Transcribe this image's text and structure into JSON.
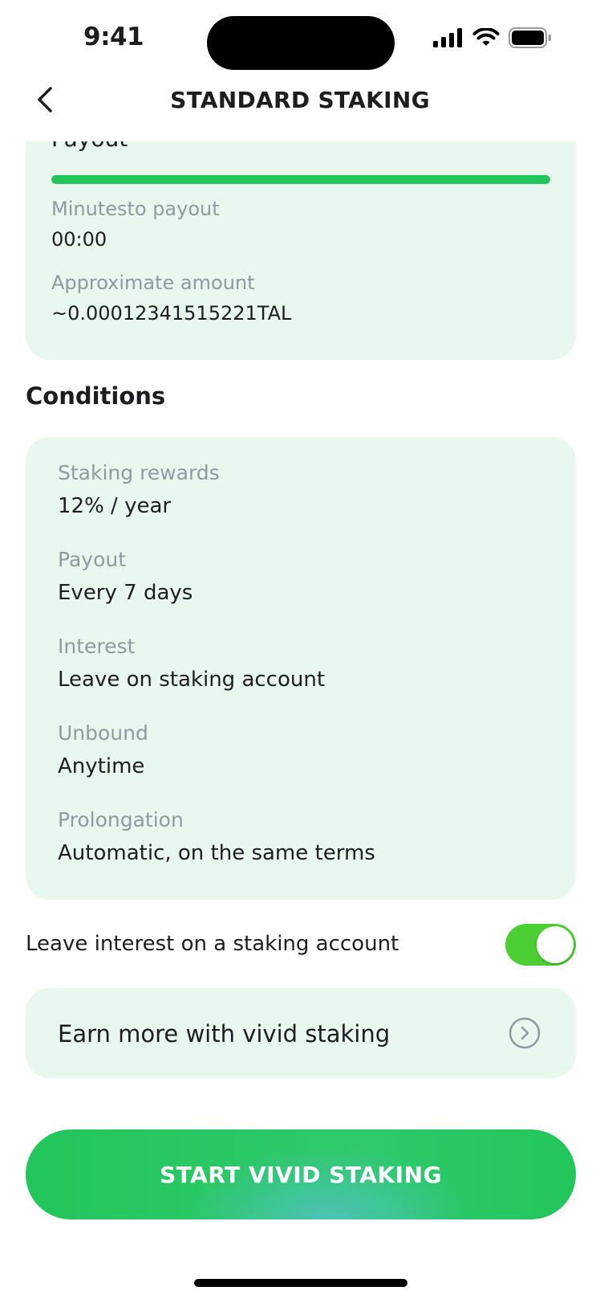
{
  "status": {
    "time": "9:41"
  },
  "header": {
    "title": "STANDARD STAKING"
  },
  "payout_card": {
    "heading": "Payout",
    "progress_percent": 100,
    "minutes_label": "Minutesto payout",
    "minutes_value": "00:00",
    "amount_label": "Approximate amount",
    "amount_value": "~0.00012341515221TAL"
  },
  "conditions": {
    "title": "Conditions",
    "items": [
      {
        "label": "Staking rewards",
        "value": "12% / year"
      },
      {
        "label": "Payout",
        "value": "Every 7 days"
      },
      {
        "label": "Interest",
        "value": "Leave on staking account"
      },
      {
        "label": "Unbound",
        "value": "Anytime"
      },
      {
        "label": "Prolongation",
        "value": "Automatic, on the same terms"
      }
    ]
  },
  "toggle": {
    "label": "Leave interest on a staking account",
    "enabled": true
  },
  "promo": {
    "text": "Earn more with vivid staking"
  },
  "cta": {
    "label": "START VIVID STAKING"
  },
  "colors": {
    "accent": "#22c65a",
    "card_bg": "#e8f8ee",
    "toggle_on": "#4ccf33"
  },
  "icons": [
    "back-chevron-icon",
    "signal-icon",
    "wifi-icon",
    "battery-icon",
    "chevron-right-circle-icon"
  ]
}
